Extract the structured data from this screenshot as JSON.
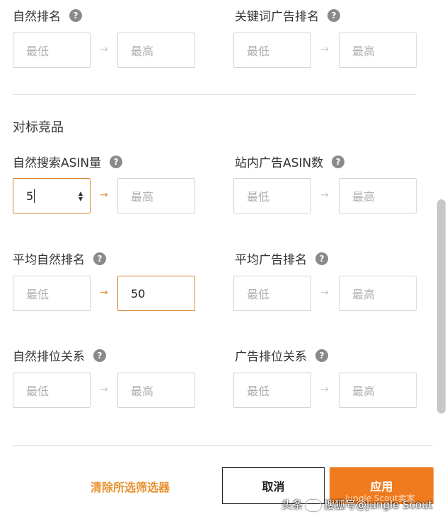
{
  "filters": {
    "natural_rank": {
      "label": "自然排名",
      "min_placeholder": "最低",
      "max_placeholder": "最高"
    },
    "keyword_ad_rank": {
      "label": "关键词广告排名",
      "min_placeholder": "最低",
      "max_placeholder": "最高"
    }
  },
  "competitor_section": {
    "title": "对标竞品",
    "natural_search_asin": {
      "label": "自然搜索ASIN量",
      "min_value": "5",
      "max_placeholder": "最高"
    },
    "onsite_ad_asin": {
      "label": "站内广告ASIN数",
      "min_placeholder": "最低",
      "max_placeholder": "最高"
    },
    "avg_natural_rank": {
      "label": "平均自然排名",
      "min_placeholder": "最低",
      "max_value": "50"
    },
    "avg_ad_rank": {
      "label": "平均广告排名",
      "min_placeholder": "最低",
      "max_placeholder": "最高"
    },
    "natural_rank_relation": {
      "label": "自然排位关系",
      "min_placeholder": "最低",
      "max_placeholder": "最高"
    },
    "ad_rank_relation": {
      "label": "广告排位关系",
      "min_placeholder": "最低",
      "max_placeholder": "最高"
    }
  },
  "help_glyph": "?",
  "arrow_glyph": "→",
  "footer": {
    "clear_label": "清除所选筛选器",
    "cancel_label": "取消",
    "apply_label": "应用"
  },
  "watermark": {
    "left": "头条",
    "right": "搜狐号@Jungle Scout",
    "overlay": "Jungle Scout卖家"
  },
  "colors": {
    "accent": "#f07b1e",
    "link": "#e8912e",
    "active_border": "#d9862f"
  }
}
